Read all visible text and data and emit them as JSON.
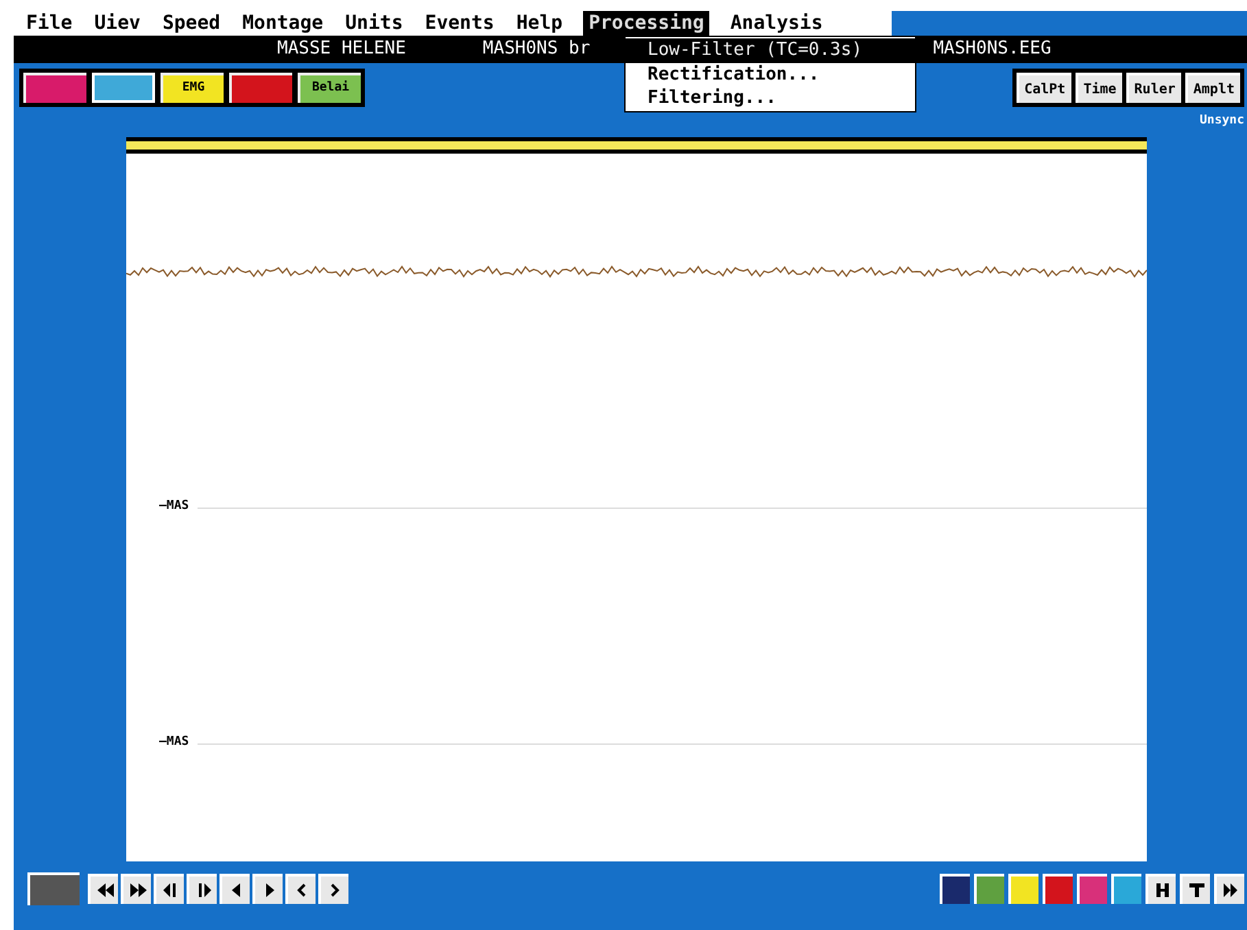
{
  "menu": [
    {
      "label": "File",
      "selected": false
    },
    {
      "label": "Uiev",
      "selected": false
    },
    {
      "label": "Speed",
      "selected": false
    },
    {
      "label": "Montage",
      "selected": false
    },
    {
      "label": "Units",
      "selected": false
    },
    {
      "label": "Events",
      "selected": false
    },
    {
      "label": "Help",
      "selected": false
    },
    {
      "label": "Processing",
      "selected": true
    },
    {
      "label": "Analysis",
      "selected": false
    }
  ],
  "title_bar": {
    "patient": "MASSE HELENE",
    "recording": "MASH0NS br",
    "file": "MASH0NS.EEG"
  },
  "dropdown": [
    {
      "label": "Low-Filter (TC=0.3s)",
      "selected": true
    },
    {
      "label": "Rectification...",
      "selected": false
    },
    {
      "label": "Filtering...",
      "selected": false
    }
  ],
  "mode_buttons": [
    {
      "color": "#d81b6a",
      "selected": false
    },
    {
      "color": "#3fa9d8",
      "selected": true
    },
    {
      "color": "#f2e422",
      "label": "EMG",
      "selected": false
    },
    {
      "color": "#d3141c",
      "selected": false
    },
    {
      "color": "#7cc050",
      "label": "Belai",
      "selected": false
    }
  ],
  "tool_buttons": [
    "CalPt",
    "Time",
    "Ruler",
    "Amplt"
  ],
  "sync_status": "Unsync",
  "channels": [
    {
      "kind": "eeg"
    },
    {
      "kind": "flat",
      "label": "—MAS"
    },
    {
      "kind": "flat",
      "label": "—MAS"
    }
  ],
  "nav_buttons": [
    {
      "kind": "rewind"
    },
    {
      "kind": "fast-forward"
    },
    {
      "kind": "page-back"
    },
    {
      "kind": "page-forward"
    },
    {
      "kind": "step-back"
    },
    {
      "kind": "step-forward"
    },
    {
      "kind": "back"
    },
    {
      "kind": "forward"
    }
  ],
  "color_buttons": [
    {
      "color": "#1a2a6c"
    },
    {
      "color": "#5fa040"
    },
    {
      "color": "#f2e422"
    },
    {
      "color": "#d3141c"
    },
    {
      "color": "#d8307a"
    },
    {
      "color": "#2aa8d8"
    }
  ],
  "end_buttons": [
    {
      "kind": "h"
    },
    {
      "kind": "t"
    },
    {
      "kind": "end"
    }
  ]
}
